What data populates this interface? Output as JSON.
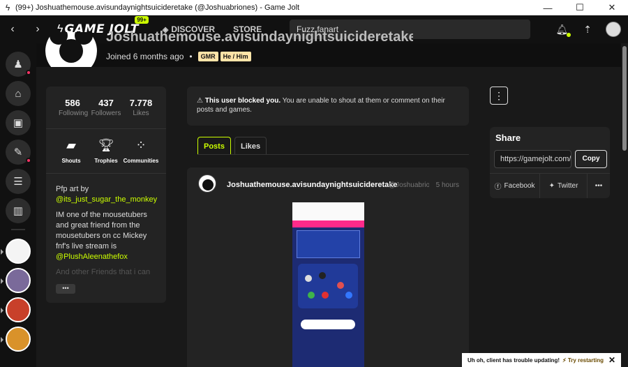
{
  "window": {
    "title": "(99+) Joshuathemouse.avisundaynightsuicideretake (@Joshuabriones) - Game Jolt",
    "minimize": "—",
    "maximize": "☐",
    "close": "✕"
  },
  "nav": {
    "back": "‹",
    "forward": "›",
    "logo_text": "GAME JOLT",
    "logo_badge": "99+",
    "discover": "DISCOVER",
    "store": "STORE",
    "more": "⋮",
    "search_value": "Fuzz fanart",
    "icons": [
      "bolt-icon",
      "compass-icon",
      "bell-icon",
      "friends-icon"
    ]
  },
  "profile": {
    "name": "Joshuathemouse.avisundaynightsuicideretake",
    "joined": "Joined 6 months ago",
    "tags": [
      "GMR",
      "He / Him"
    ]
  },
  "stats": [
    {
      "value": "586",
      "label": "Following"
    },
    {
      "value": "437",
      "label": "Followers"
    },
    {
      "value": "7.778",
      "label": "Likes"
    }
  ],
  "quick_links": [
    {
      "label": "Shouts",
      "icon": "chat-icon"
    },
    {
      "label": "Trophies",
      "icon": "trophy-icon"
    },
    {
      "label": "Communities",
      "icon": "grid-icon"
    }
  ],
  "bio": {
    "line1": "Pfp art by",
    "link1": "@its_just_sugar_the_monkey",
    "para2": "IM one of the mousetubers and great friend from the mousetubers on cc Mickey fnf's live stream is",
    "link2": "@PlushAleenathefox",
    "faded": "And other Friends that i can",
    "more": "•••"
  },
  "blocked": {
    "bold": "This user blocked you.",
    "rest": " You are unable to shout at them or comment on their posts and games."
  },
  "tabs": [
    "Posts",
    "Likes"
  ],
  "post": {
    "author": "Joshuathemouse.avisundaynightsuicideretake",
    "handle": "@Joshuabriones",
    "time": "5 hours"
  },
  "share": {
    "title": "Share",
    "url": "https://gamejolt.com/@Joshuabriones",
    "copy": "Copy",
    "facebook": "Facebook",
    "twitter": "Twitter",
    "more": "•••"
  },
  "toast": {
    "message": "Uh oh, client has trouble updating!",
    "action": "Try restarting",
    "close": "✕"
  },
  "colors": {
    "accent": "#ccff00",
    "notification": "#ff3366",
    "background": "#191919",
    "card": "#232323"
  }
}
